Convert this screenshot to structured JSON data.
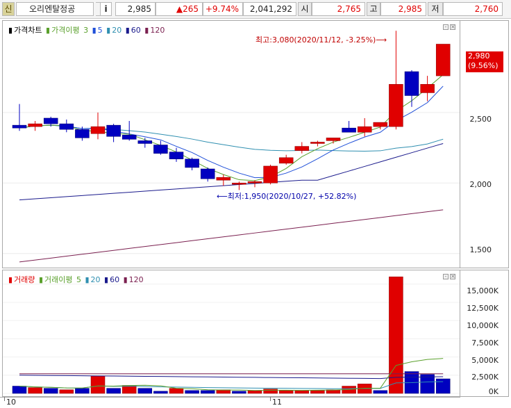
{
  "topbar": {
    "market_badge": "신",
    "stock_name": "오리엔탈정공",
    "info_btn": "i",
    "price": "2,985",
    "change": "▲265",
    "change_pct": "+9.74%",
    "volume": "2,041,292",
    "open_label": "시",
    "open_value": "2,765",
    "high_label": "고",
    "high_value": "2,985",
    "low_label": "저",
    "low_value": "2,760"
  },
  "price_panel": {
    "legend": {
      "chart_label": "가격차트",
      "ma_label": "가격이평",
      "ma_periods": [
        "3",
        "5",
        "20",
        "60",
        "120"
      ]
    },
    "annotation_high": "최고:3,080(2020/11/12, -3.25%)",
    "annotation_low": "최저:1,950(2020/10/27, +52.82%)",
    "current_price_tag": "2,980",
    "current_pct_tag": "(9.56%)",
    "y_ticks": [
      "2,500",
      "2,000",
      "1,500"
    ]
  },
  "volume_panel": {
    "legend": {
      "chart_label": "거래량",
      "ma_label": "거래이평",
      "ma_periods": [
        "5",
        "20",
        "60",
        "120"
      ]
    },
    "y_ticks": [
      "15,000K",
      "12,500K",
      "10,000K",
      "7,500K",
      "5,000K",
      "2,500K",
      "0K"
    ]
  },
  "x_axis": {
    "labels": [
      "10",
      "11"
    ]
  },
  "colors": {
    "up": "#e00000",
    "down": "#0000c0",
    "ma3": "#5aa02c",
    "ma5": "#1f4fd8",
    "ma20": "#2f8fb0",
    "ma60": "#1a1a8c",
    "ma120": "#7a1f4f"
  },
  "chart_data": [
    {
      "type": "candlestick",
      "title": "가격차트",
      "x": [
        "10월 초",
        "",
        "",
        "",
        "",
        "",
        "",
        "",
        "",
        "",
        "",
        "",
        "",
        "",
        "",
        "",
        "",
        "11월",
        "",
        "",
        "",
        "",
        "",
        "",
        "",
        "",
        "",
        "",
        ""
      ],
      "ohlc": [
        [
          2410,
          2560,
          2370,
          2390
        ],
        [
          2400,
          2440,
          2370,
          2420
        ],
        [
          2460,
          2470,
          2400,
          2420
        ],
        [
          2420,
          2450,
          2360,
          2380
        ],
        [
          2380,
          2400,
          2300,
          2320
        ],
        [
          2350,
          2500,
          2310,
          2400
        ],
        [
          2410,
          2420,
          2290,
          2330
        ],
        [
          2340,
          2440,
          2300,
          2310
        ],
        [
          2300,
          2320,
          2250,
          2280
        ],
        [
          2270,
          2300,
          2200,
          2210
        ],
        [
          2220,
          2250,
          2150,
          2170
        ],
        [
          2170,
          2180,
          2090,
          2110
        ],
        [
          2100,
          2110,
          2010,
          2030
        ],
        [
          2020,
          2060,
          1980,
          2040
        ],
        [
          2000,
          2010,
          1950,
          2000
        ],
        [
          2000,
          2020,
          1970,
          2010
        ],
        [
          2000,
          2130,
          1990,
          2120
        ],
        [
          2140,
          2200,
          2130,
          2180
        ],
        [
          2230,
          2290,
          2210,
          2260
        ],
        [
          2280,
          2300,
          2260,
          2290
        ],
        [
          2300,
          2320,
          2280,
          2320
        ],
        [
          2390,
          2440,
          2370,
          2360
        ],
        [
          2360,
          2460,
          2330,
          2400
        ],
        [
          2400,
          2420,
          2380,
          2430
        ],
        [
          2400,
          3080,
          2380,
          2700
        ],
        [
          2790,
          2800,
          2540,
          2620
        ],
        [
          2640,
          2760,
          2580,
          2700
        ],
        [
          2760,
          2985,
          2760,
          2985
        ]
      ],
      "ylim": [
        1400,
        3150
      ],
      "y_ticks": [
        2500,
        2000,
        1500
      ],
      "high": 3080,
      "low": 1950
    },
    {
      "type": "bar",
      "title": "거래량",
      "unit": "K",
      "values": [
        1000,
        800,
        700,
        500,
        700,
        2400,
        700,
        1100,
        700,
        300,
        700,
        400,
        400,
        500,
        300,
        400,
        600,
        400,
        400,
        400,
        500,
        1000,
        1300,
        400,
        16000,
        3000,
        2600,
        2000
      ],
      "up": [
        false,
        true,
        false,
        true,
        false,
        true,
        false,
        true,
        false,
        false,
        true,
        false,
        false,
        true,
        false,
        true,
        true,
        true,
        true,
        true,
        true,
        true,
        true,
        false,
        true,
        false,
        false,
        false
      ],
      "ylim": [
        0,
        16500
      ],
      "y_ticks": [
        15000,
        12500,
        10000,
        7500,
        5000,
        2500,
        0
      ]
    }
  ]
}
